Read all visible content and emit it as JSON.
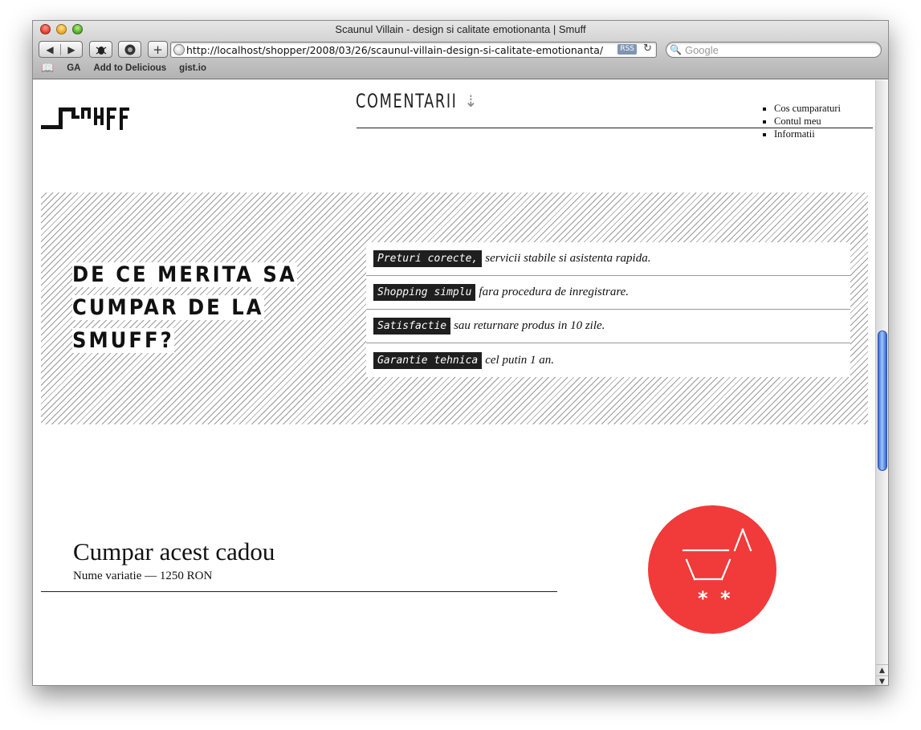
{
  "browser": {
    "title": "Scaunul Villain - design si calitate emotionanta | Smuff",
    "url": "http://localhost/shopper/2008/03/26/scaunul-villain-design-si-calitate-emotionanta/",
    "rss_label": "RSS",
    "search_placeholder": "Google",
    "bookmarks": [
      "GA",
      "Add to Delicious",
      "gist.io"
    ]
  },
  "header": {
    "section_title": "COMENTARII",
    "menu": [
      "Cos cumparaturi",
      "Contul meu",
      "Informatii"
    ]
  },
  "why": {
    "title_line1": "DE CE MERITA SA",
    "title_line2": "CUMPAR DE LA SMUFF?",
    "features": [
      {
        "tag": "Preturi corecte,",
        "text": "servicii stabile si asistenta rapida."
      },
      {
        "tag": "Shopping simplu",
        "text": "fara procedura de inregistrare."
      },
      {
        "tag": "Satisfactie",
        "text": "sau returnare produs in 10 zile."
      },
      {
        "tag": "Garantie tehnica",
        "text": "cel putin 1 an."
      }
    ]
  },
  "gift": {
    "title": "Cumpar acest cadou",
    "variation": "Nume variatie — 1250 RON"
  },
  "colors": {
    "cart_circle": "#f13a3a",
    "tag_background": "#1f1f1f",
    "scroll_thumb": "#3a6ed8"
  },
  "icons": [
    "back-icon",
    "forward-icon",
    "bug-icon",
    "snapshot-icon",
    "add-bookmark-icon",
    "globe-icon",
    "reload-icon",
    "search-icon",
    "bookmarks-book-icon",
    "down-arrow-icon",
    "shopping-cart-icon"
  ]
}
